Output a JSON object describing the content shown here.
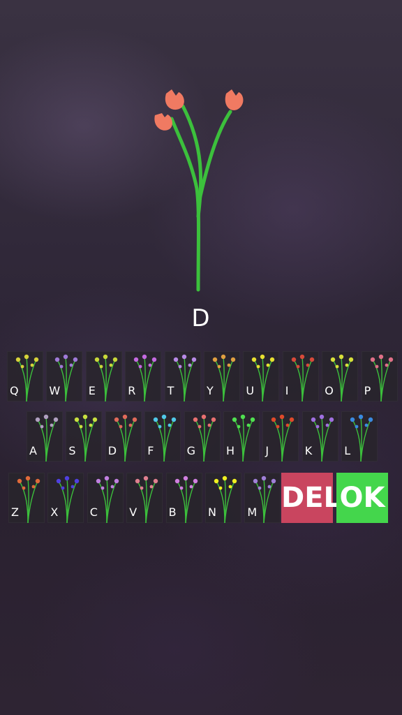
{
  "current_letter": "D",
  "keyboard": {
    "rows": [
      [
        "Q",
        "W",
        "E",
        "R",
        "T",
        "Y",
        "U",
        "I",
        "O",
        "P"
      ],
      [
        "A",
        "S",
        "D",
        "F",
        "G",
        "H",
        "J",
        "K",
        "L"
      ],
      [
        "Z",
        "X",
        "C",
        "V",
        "B",
        "N",
        "M"
      ]
    ],
    "flower_colors": {
      "Q": "#d6d23a",
      "W": "#a07ad8",
      "E": "#c8d83a",
      "R": "#c46ae0",
      "T": "#b88ae6",
      "Y": "#e0a040",
      "U": "#e8e030",
      "I": "#d84a3a",
      "O": "#d8e03a",
      "P": "#e07088",
      "A": "#b0a0c0",
      "S": "#c8e040",
      "D": "#e06a5a",
      "F": "#50c8e8",
      "G": "#e87070",
      "H": "#50e050",
      "J": "#e04a2a",
      "K": "#a070e0",
      "L": "#3a8ae0",
      "Z": "#e06a3a",
      "X": "#5040e0",
      "C": "#c080e0",
      "V": "#e08090",
      "B": "#d080e0",
      "N": "#f0f020",
      "M": "#a080d8"
    },
    "delete_label": "DEL",
    "ok_label": "OK"
  },
  "colors": {
    "hero_flower": "#f07a62",
    "stem": "#3cc03c",
    "delete_bg": "#c9455f",
    "ok_bg": "#44d64c"
  }
}
